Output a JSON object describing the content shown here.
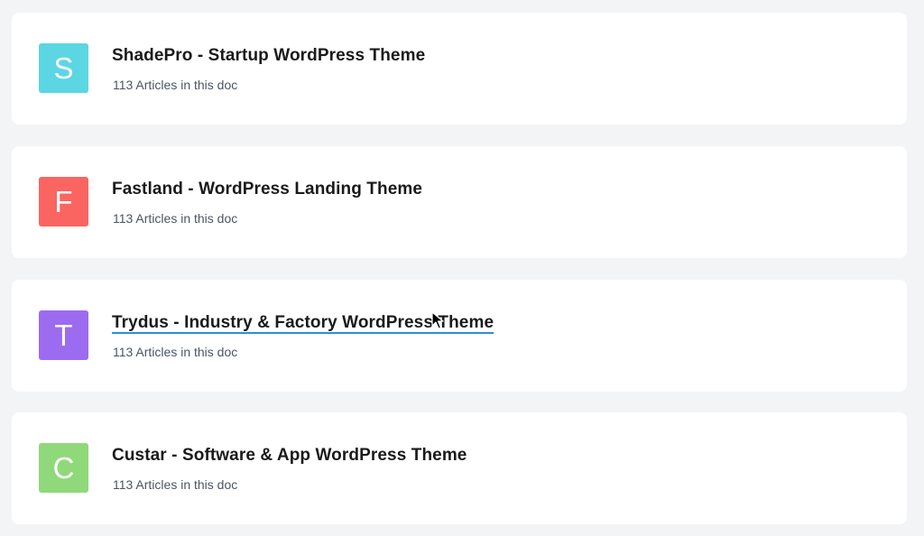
{
  "docs": [
    {
      "letter": "S",
      "title": "ShadePro - Startup WordPress Theme",
      "subtitle": "113 Articles in this doc",
      "color": "#5dd6e3"
    },
    {
      "letter": "F",
      "title": "Fastland - WordPress Landing Theme",
      "subtitle": "113 Articles in this doc",
      "color": "#fa6561"
    },
    {
      "letter": "T",
      "title": "Trydus - Industry & Factory WordPress Theme",
      "subtitle": "113 Articles in this doc",
      "color": "#9b6cf0"
    },
    {
      "letter": "C",
      "title": "Custar - Software & App WordPress Theme",
      "subtitle": "113 Articles in this doc",
      "color": "#8fd97a"
    }
  ],
  "cursor_icon": "mouse-pointer-icon"
}
